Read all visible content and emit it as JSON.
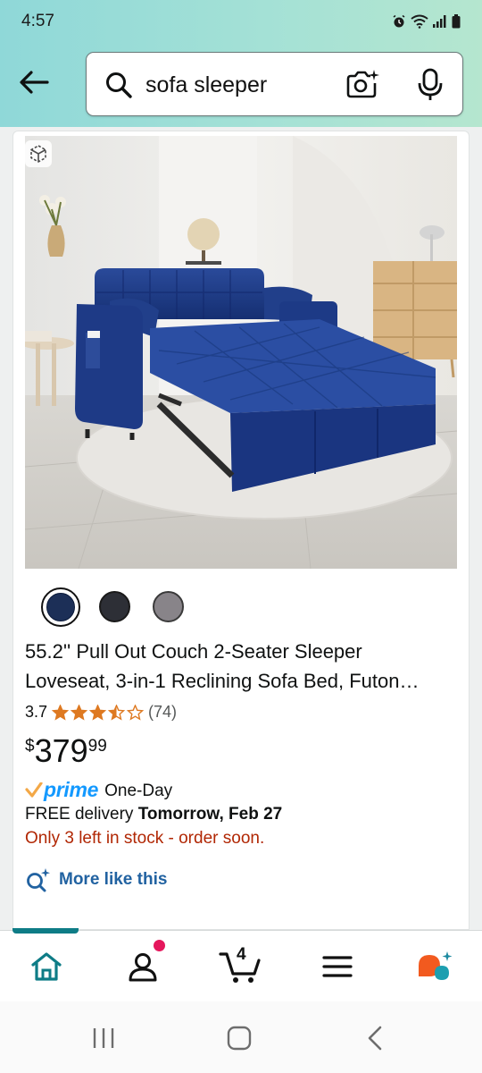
{
  "status_bar": {
    "time": "4:57"
  },
  "search": {
    "query": "sofa sleeper",
    "icons": [
      "search-icon",
      "camera-icon",
      "mic-icon"
    ]
  },
  "product": {
    "image_alt": "blue velvet pull out sleeper loveseat",
    "color_swatches": [
      {
        "name": "navy",
        "color": "#1c2f57",
        "selected": true
      },
      {
        "name": "black",
        "color": "#2d2f36",
        "selected": false
      },
      {
        "name": "gray",
        "color": "#888489",
        "selected": false
      }
    ],
    "title_line1": "55.2'' Pull Out Couch 2-Seater Sleeper",
    "title_line2": "Loveseat, 3-in-1 Reclining Sofa Bed, Futon…",
    "rating_value": "3.7",
    "rating_stars": 3.7,
    "rating_count": "(74)",
    "price_symbol": "$",
    "price_whole": "379",
    "price_fraction": "99",
    "prime_label": "prime",
    "prime_speed": "One-Day",
    "delivery_prefix": "FREE delivery ",
    "delivery_date": "Tomorrow, Feb 27",
    "stock_warning": "Only 3 left in stock - order soon.",
    "more_like_this": "More like this"
  },
  "bottom_nav": {
    "items": [
      "home",
      "account",
      "cart",
      "menu",
      "rufus"
    ],
    "cart_count": "4",
    "active": "home"
  },
  "colors": {
    "header_gradient_start": "#8fd8d8",
    "header_gradient_end": "#b5e6cf",
    "price_text": "#0f1111",
    "prime_blue": "#1399ff",
    "stock_red": "#b12704",
    "link_blue": "#2162a1",
    "star_orange": "#de7921",
    "nav_active": "#0e7c86"
  }
}
